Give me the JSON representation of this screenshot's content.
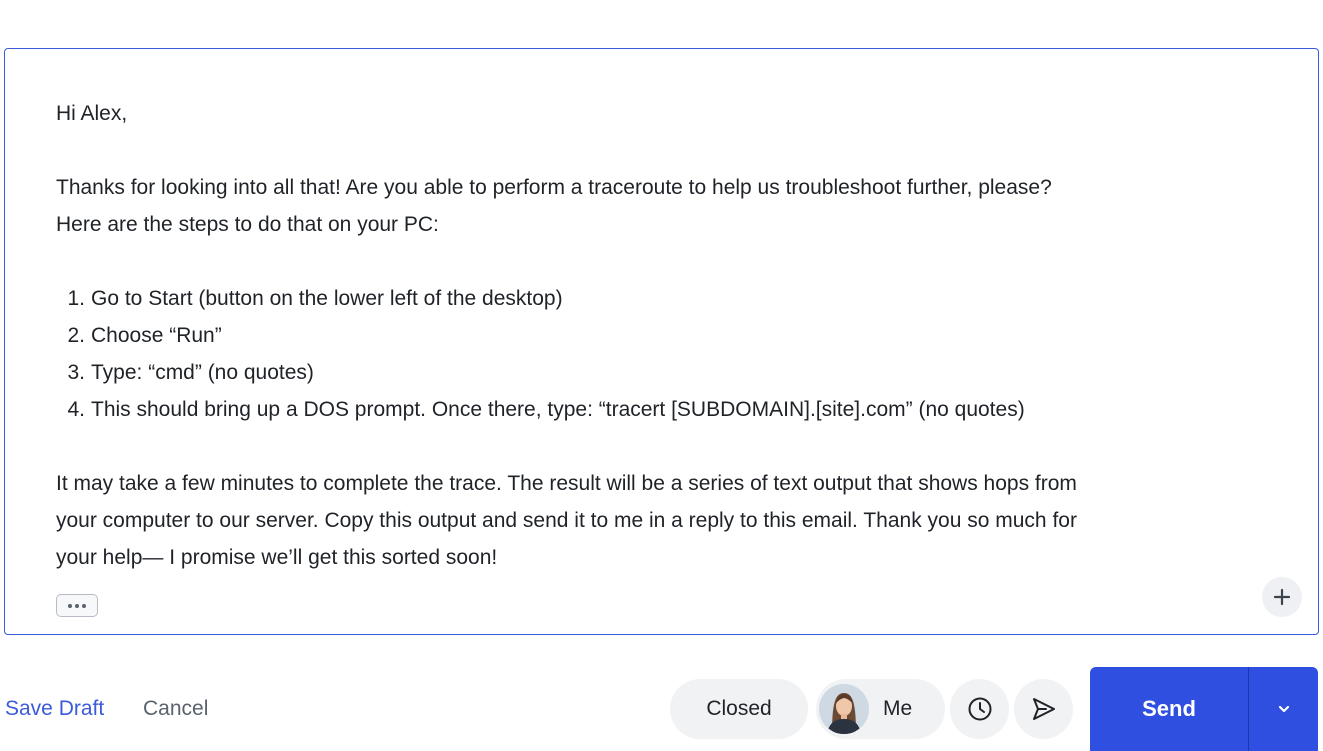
{
  "email": {
    "greeting": "Hi Alex,",
    "intro_line1": "Thanks for looking into all that! Are you able to perform a traceroute to help us troubleshoot further, please?",
    "intro_line2": "Here are the steps to do that on your PC:",
    "steps": [
      {
        "num": "1.",
        "text": "Go to Start (button on the lower left of the desktop)"
      },
      {
        "num": "2.",
        "text": "Choose “Run”"
      },
      {
        "num": "3.",
        "text": "Type: “cmd” (no quotes)"
      },
      {
        "num": "4.",
        "text": "This should bring up a DOS prompt. Once there, type: “tracert [SUBDOMAIN].[site].com” (no quotes)"
      }
    ],
    "closing_line1": "It may take a few minutes to complete the trace. The result will be a series of text output that shows hops from",
    "closing_line2": "your computer to our server. Copy this output and send it to me in a reply to this email. Thank you so much for",
    "closing_line3": "your help— I promise we’ll get this sorted soon!"
  },
  "footer": {
    "save_draft": "Save Draft",
    "cancel": "Cancel",
    "status": "Closed",
    "assignee": "Me",
    "send": "Send"
  },
  "icons": {
    "more": "ellipsis-icon",
    "plus": "plus-icon",
    "clock": "clock-icon",
    "send_later": "paper-plane-icon",
    "caret": "chevron-down-icon"
  },
  "colors": {
    "accent": "#2f4fe0",
    "link": "#3b5bdb",
    "editor_border": "#3b5bdb",
    "pill_bg": "#f1f2f4"
  }
}
